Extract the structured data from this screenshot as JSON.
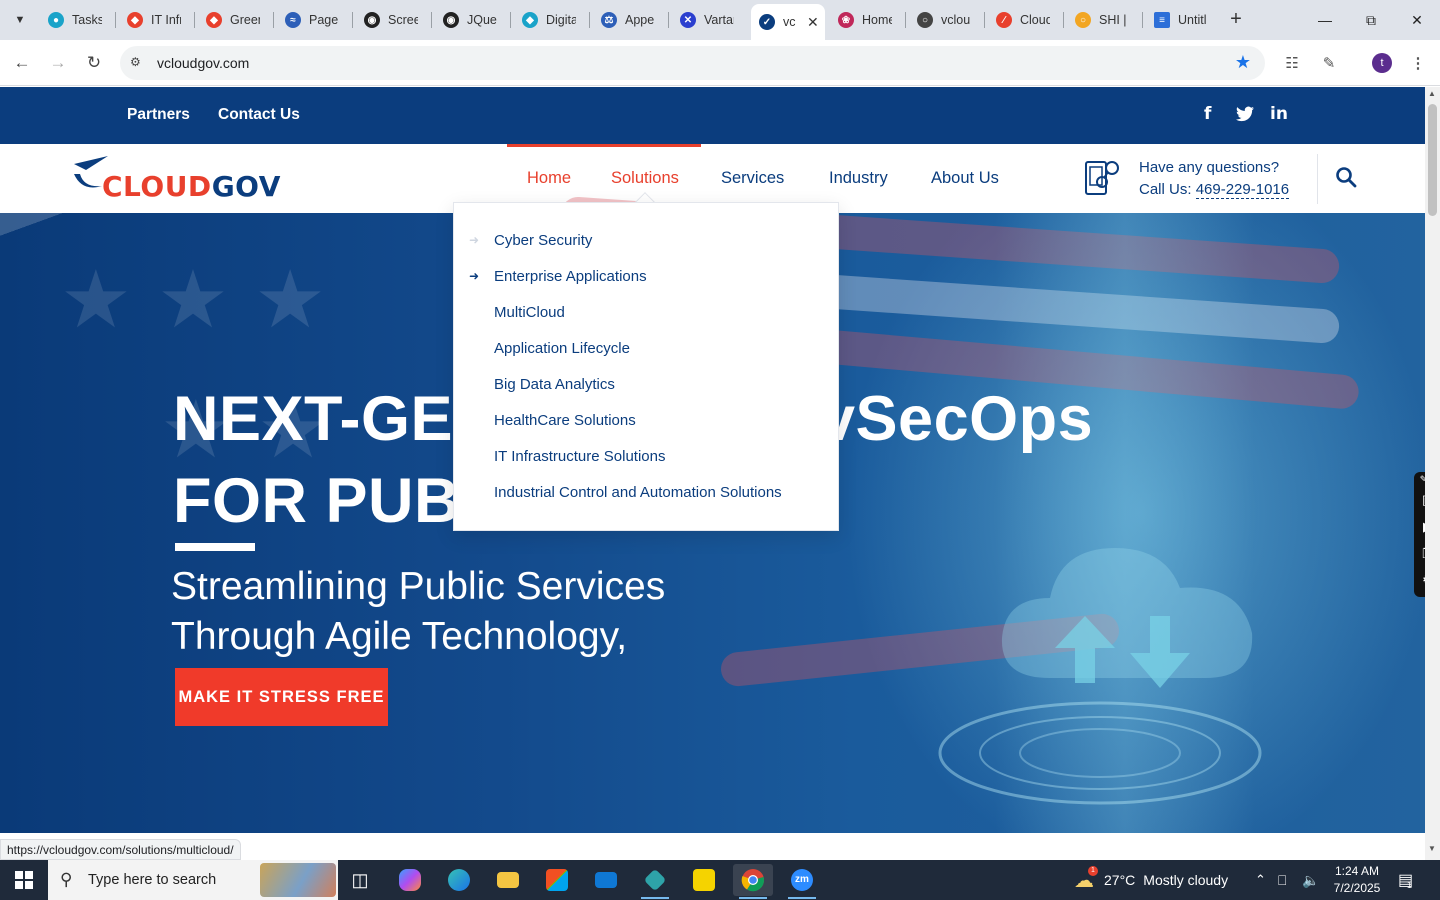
{
  "browser": {
    "tabs": [
      {
        "title": "Tasks",
        "color": "#1aa3c9"
      },
      {
        "title": "IT Infra",
        "color": "#e8402d"
      },
      {
        "title": "Green",
        "color": "#e8402d"
      },
      {
        "title": "PageS",
        "color": "#2d5fb8"
      },
      {
        "title": "Screen",
        "color": "#222222"
      },
      {
        "title": "JQuery",
        "color": "#222222"
      },
      {
        "title": "Digita",
        "color": "#1aa3c9"
      },
      {
        "title": "Appe",
        "color": "#2d5fb8"
      },
      {
        "title": "Vartar",
        "color": "#2b3fcf"
      },
      {
        "title": "vc",
        "color": "#0b3d7e"
      },
      {
        "title": "Home",
        "color": "#c0285a"
      },
      {
        "title": "vclou",
        "color": "#444444"
      },
      {
        "title": "Cloud",
        "color": "#e8402d"
      },
      {
        "title": "SHI |",
        "color": "#f2a623"
      },
      {
        "title": "Untitl",
        "color": "#2d6fd8"
      }
    ],
    "url": "vcloudgov.com",
    "profile_initial": "t",
    "status_url": "https://vcloudgov.com/solutions/multicloud/"
  },
  "site": {
    "topbar_links": [
      "Partners",
      "Contact Us"
    ],
    "social": [
      "f",
      "t",
      "in"
    ],
    "logo": {
      "part1": "CLOUD",
      "part2": "GOV"
    },
    "nav": [
      "Home",
      "Solutions",
      "Services",
      "Industry",
      "About Us"
    ],
    "contact": {
      "question": "Have any questions?",
      "call_prefix": "Call Us: ",
      "phone": "469-229-1016"
    },
    "dropdown": [
      "Cyber Security",
      "Enterprise Applications",
      "MultiCloud",
      "Application Lifecycle",
      "Big Data Analytics",
      "HealthCare Solutions",
      "IT Infrastructure Solutions",
      "Industrial Control and Automation Solutions"
    ],
    "hero": {
      "line1_left": "NEXT-GEN",
      "line1_right": "vSecOps",
      "line2": "FOR PUBL",
      "sub1": "Streamlining Public Services",
      "sub2": "Through Agile Technology,",
      "cta": "MAKE IT STRESS FREE"
    },
    "colors": {
      "brand_blue": "#0b3d7e",
      "brand_red": "#e8402d"
    }
  },
  "taskbar": {
    "search_placeholder": "Type here to search",
    "weather_temp": "27°C",
    "weather_desc": "Mostly cloudy",
    "time": "1:24 AM",
    "date": "7/2/2025",
    "notification_count": "1",
    "weather_badge": "1"
  }
}
